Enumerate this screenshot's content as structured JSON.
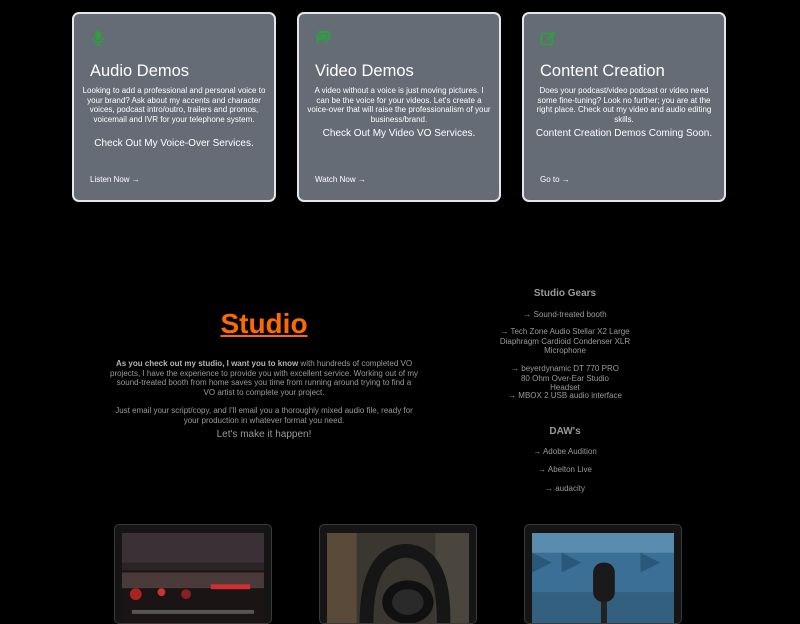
{
  "cards": [
    {
      "title": "Audio Demos",
      "icon": "microphone-icon",
      "desc": "Looking to add a professional and personal voice to your brand? Ask about my accents and character voices, podcast intro/outro, trailers and promos, voicemail and IVR for your telephone system.",
      "cta": "Check Out My Voice-Over Services.",
      "link": "Listen Now →"
    },
    {
      "title": "Video Demos",
      "icon": "images-icon",
      "desc": "A video without a voice is just moving pictures. I can be the voice for your videos. Let's create a voice-over that will raise the professionalism of your business/brand.",
      "cta": "Check Out My Video VO Services.",
      "link": "Watch Now →"
    },
    {
      "title": "Content Creation",
      "icon": "edit-icon",
      "desc": "Does your podcast/video podcast or video need some fine-tuning? Look no further; you are at the right place. Check out my video and audio editing skills.",
      "cta": "Content Creation Demos Coming Soon.",
      "link": "Go to →"
    }
  ],
  "studio": {
    "title": "Studio",
    "lead": "As you check out my studio, I want you to know",
    "body1": " with hundreds of completed VO projects, I have the experience to provide you with excellent service. Working out of my sound-treated booth from home saves you time from running around trying to find a VO artist to complete your project.",
    "body2": "Just email your script/copy, and I'll email you a thoroughly mixed audio file, ready for your production in whatever format you need.",
    "cta": "Let's make it happen!"
  },
  "gears": {
    "heading": "Studio Gears",
    "items": [
      "→ Sound-treated booth",
      "→ Tech Zone Audio Stellar X2 Large Diaphragm Cardioid Condenser XLR Microphone",
      "→ beyerdynamic DT 770 PRO 80 Ohm Over-Ear Studio Headset",
      "→ MBOX 2 USB audio interface"
    ]
  },
  "daws": {
    "heading": "DAW's",
    "items": [
      "→ Adobe Audition",
      "→ Abelton Live",
      "→ audacity"
    ]
  },
  "colors": {
    "accent": "#ff6a00",
    "card_bg": "#656c75",
    "icon_green": "#2e9e3f"
  }
}
